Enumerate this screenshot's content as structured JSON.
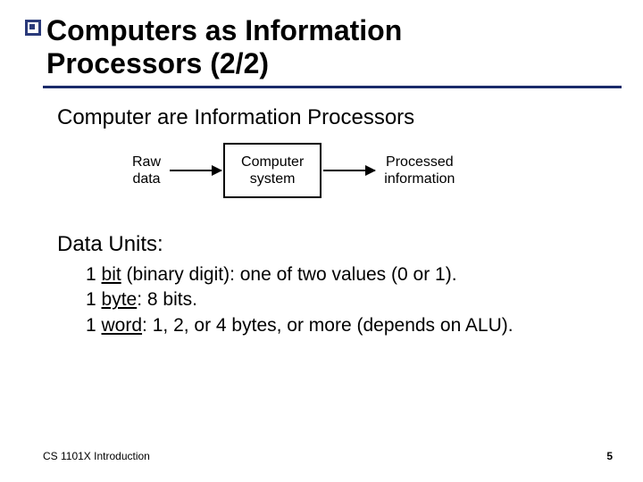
{
  "title_line1": "Computers as Information",
  "title_line2": "Processors (2/2)",
  "subhead": "Computer are Information Processors",
  "diagram": {
    "input_l1": "Raw",
    "input_l2": "data",
    "box_l1": "Computer",
    "box_l2": "system",
    "output_l1": "Processed",
    "output_l2": "information"
  },
  "units_head": "Data Units:",
  "units": {
    "bit_prefix": "1 ",
    "bit_term": "bit",
    "bit_rest": " (binary digit): one of two values (0 or 1).",
    "byte_prefix": "1 ",
    "byte_term": "byte",
    "byte_rest": ": 8 bits.",
    "word_prefix": "1 ",
    "word_term": "word",
    "word_rest": ": 1, 2, or 4 bytes, or more (depends on ALU)."
  },
  "footer_left": "CS 1101X Introduction",
  "footer_right": "5"
}
